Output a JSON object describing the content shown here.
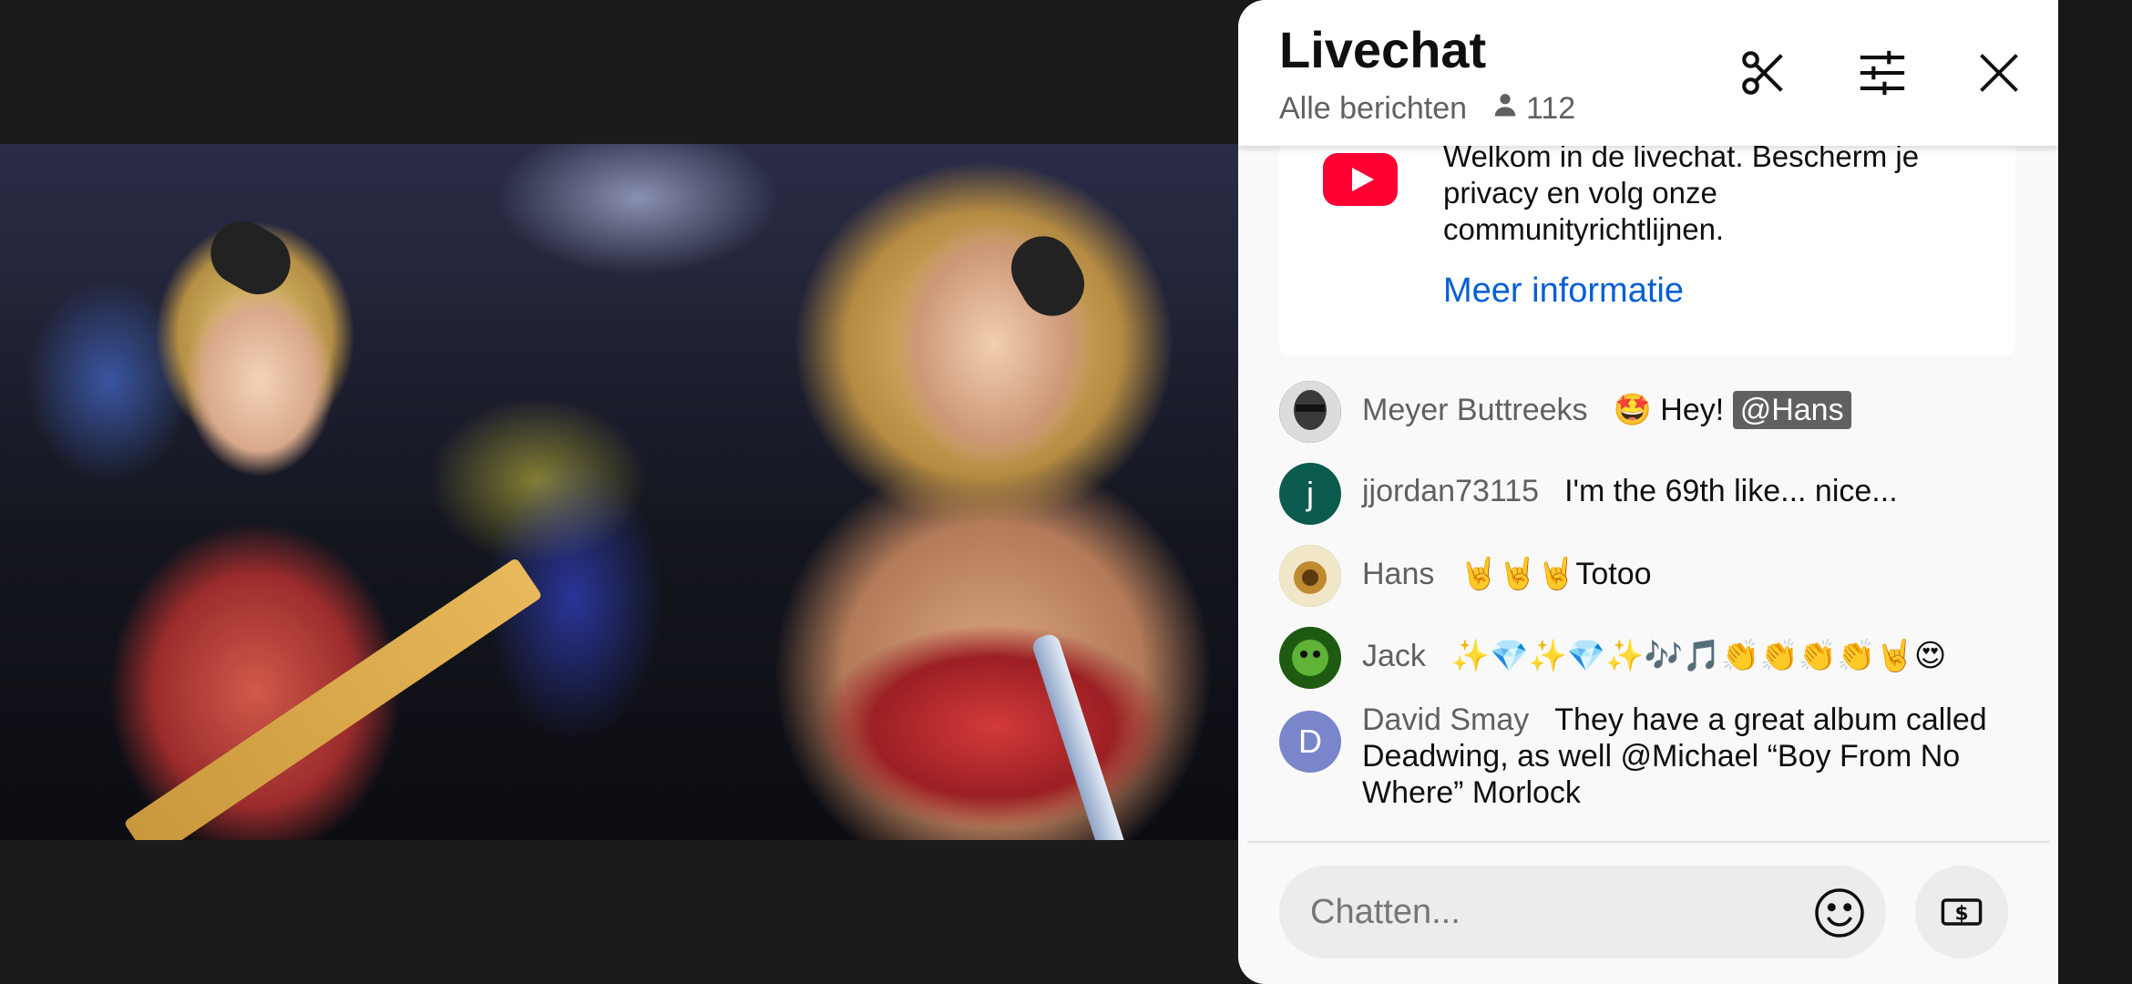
{
  "chat": {
    "title": "Livechat",
    "filter_label": "Alle berichten",
    "viewer_count": "112",
    "header_icons": [
      "scissors-icon",
      "sliders-icon",
      "close-icon"
    ],
    "welcome": {
      "text": "Welkom in de livechat. Bescherm je privacy en volg onze communityrichtlijnen.",
      "link": "Meer informatie"
    },
    "messages": [
      {
        "author": "Meyer Buttreeks",
        "text": "🤩 Hey!",
        "mention": "@Hans",
        "avatar_color": "#3a3a3a"
      },
      {
        "author": "jjordan73115",
        "text": "I'm the 69th like... nice...",
        "avatar_letter": "j",
        "avatar_color": "#0b5b4e"
      },
      {
        "author": "Hans",
        "text": "🤘🤘🤘Totoo",
        "avatar_color": "#b07a2a"
      },
      {
        "author": "Jack",
        "text": "✨💎✨💎✨🎶🎵👏👏👏👏🤘😍",
        "avatar_color": "#2f7d1f"
      },
      {
        "author": "David Smay",
        "text": "They have a great album called Deadwing, as well @Michael “Boy From No Where” Morlock",
        "avatar_letter": "D",
        "avatar_color": "#7986cb"
      }
    ],
    "input_placeholder": "Chatten..."
  },
  "colors": {
    "accent_link": "#065fd4",
    "youtube_red": "#ff0033"
  }
}
